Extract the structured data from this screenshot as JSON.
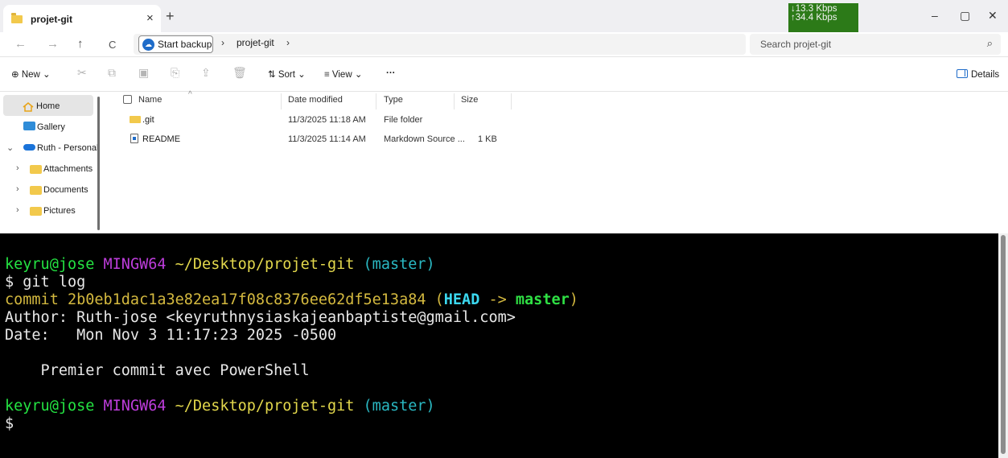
{
  "explorer": {
    "tab_title": "projet-git",
    "tab_close": "×",
    "new_tab": "+",
    "network": {
      "down": "↓13.3 Kbps",
      "up": "↑34.4 Kbps"
    },
    "window_controls": {
      "minimize": "–",
      "maximize": "▢",
      "close": "✕"
    },
    "nav": {
      "back": "←",
      "forward": "→",
      "up": "↑",
      "refresh": "C"
    },
    "address": {
      "backup_label": "Start backup",
      "sep1": "›",
      "crumb": "projet-git",
      "sep2": "›"
    },
    "search": {
      "placeholder": "Search projet-git",
      "icon": "⌕"
    },
    "toolbar": {
      "new": "⊕  New ⌄",
      "cut": "✂",
      "copy": "⧉",
      "paste": "▣",
      "rename": "⎘",
      "share": "⇪",
      "delete": "🗑",
      "sort": "⇅  Sort ⌄",
      "view": "≡  View ⌄",
      "more": "···",
      "details": "Details"
    },
    "sidebar": {
      "home": "Home",
      "gallery": "Gallery",
      "onedrive": "Ruth - Personal",
      "attachments": "Attachments",
      "documents": "Documents",
      "pictures": "Pictures"
    },
    "columns": {
      "name": "Name",
      "date": "Date modified",
      "type": "Type",
      "size": "Size"
    },
    "files": [
      {
        "name": ".git",
        "date": "11/3/2025 11:18 AM",
        "type": "File folder",
        "size": ""
      },
      {
        "name": "README",
        "date": "11/3/2025 11:14 AM",
        "type": "Markdown Source ...",
        "size": "1 KB"
      }
    ]
  },
  "terminal": {
    "prompt1": {
      "user": "keyru@jose",
      "shell": "MINGW64",
      "path": "~/Desktop/projet-git",
      "branch": "(master)"
    },
    "command": "$ git log",
    "commit": {
      "label": "commit",
      "hash": "2b0eb1dac1a3e82ea17f08c8376ee62df5e13a84",
      "open": "(",
      "head": "HEAD",
      "arrow": "->",
      "branch": "master",
      "close": ")"
    },
    "author": "Author: Ruth-jose <keyruthnysiaskajeanbaptiste@gmail.com>",
    "date": "Date:   Mon Nov 3 11:17:23 2025 -0500",
    "message": "    Premier commit avec PowerShell",
    "prompt2": {
      "user": "keyru@jose",
      "shell": "MINGW64",
      "path": "~/Desktop/projet-git",
      "branch": "(master)"
    },
    "cursor_line": "$"
  }
}
